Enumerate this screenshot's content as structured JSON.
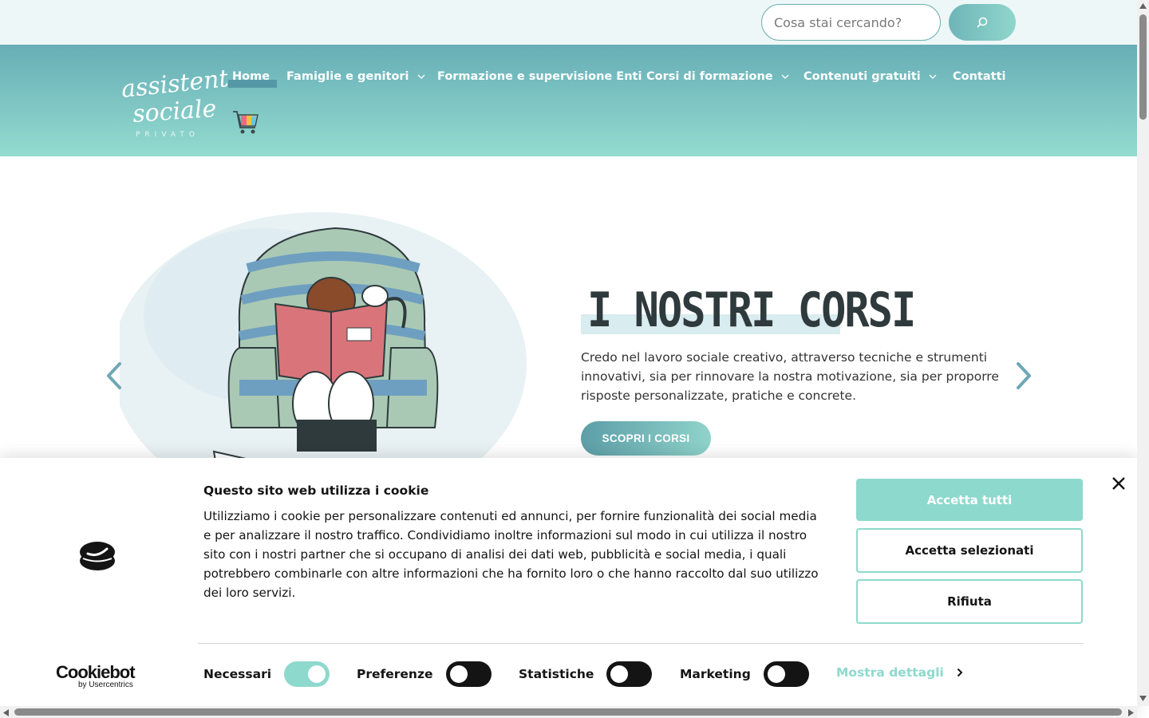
{
  "search": {
    "placeholder": "Cosa stai cercando?",
    "button_icon": "search-icon"
  },
  "brand": {
    "logo_line1": "assistente",
    "logo_line2": "sociale",
    "logo_line3": "PRIVATO"
  },
  "nav": {
    "items": [
      {
        "label": "Home",
        "active": true,
        "dropdown": false
      },
      {
        "label": "Famiglie e genitori",
        "dropdown": true
      },
      {
        "label": "Formazione e supervisione Enti",
        "dropdown": false
      },
      {
        "label": "Corsi di formazione",
        "dropdown": true
      },
      {
        "label": "Contenuti gratuiti",
        "dropdown": true
      },
      {
        "label": "Contatti",
        "dropdown": false
      }
    ],
    "cart_icon": "shopping-cart-icon"
  },
  "hero": {
    "title": "I NOSTRI CORSI",
    "text": "Credo nel lavoro sociale creativo, attraverso tecniche e strumenti innovativi, sia per rinnovare la nostra motivazione, sia per proporre risposte personalizzate, pratiche e concrete.",
    "cta_label": "SCOPRI I CORSI",
    "prev_icon": "chevron-left-icon",
    "next_icon": "chevron-right-icon"
  },
  "cookie_banner": {
    "title": "Questo sito web utilizza i cookie",
    "text": "Utilizziamo i cookie per personalizzare contenuti ed annunci, per fornire funzionalità dei social media e per analizzare il nostro traffico. Condividiamo inoltre informazioni sul modo in cui utilizza il nostro sito con i nostri partner che si occupano di analisi dei dati web, pubblicità e social media, i quali potrebbero combinarle con altre informazioni che ha fornito loro o che hanno raccolto dal suo utilizzo dei loro servizi.",
    "buttons": {
      "accept_all": "Accetta tutti",
      "accept_selected": "Accetta selezionati",
      "reject": "Rifiuta"
    },
    "consents": [
      {
        "label": "Necessari",
        "enabled": true
      },
      {
        "label": "Preferenze",
        "enabled": false
      },
      {
        "label": "Statistiche",
        "enabled": false
      },
      {
        "label": "Marketing",
        "enabled": false
      }
    ],
    "show_details": "Mostra dettagli",
    "powered_by_word": "Cookiebot",
    "powered_by_sub": "by Usercentrics"
  },
  "colors": {
    "header_top": "#67aeb6",
    "header_bottom": "#93dccf",
    "accent": "#8ed9cd",
    "text_dark": "#141414"
  }
}
